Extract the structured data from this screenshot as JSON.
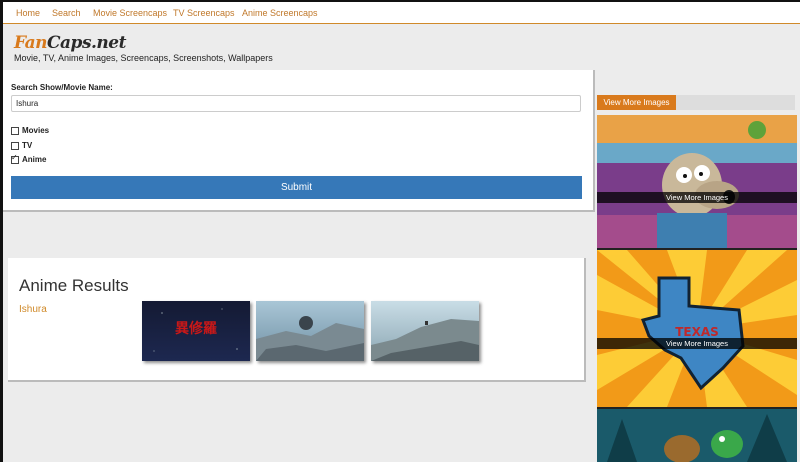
{
  "nav": {
    "items": [
      "Home",
      "Search",
      "Movie Screencaps",
      "TV Screencaps",
      "Anime Screencaps"
    ]
  },
  "logo": {
    "part1": "Fan",
    "part2": "Caps.net"
  },
  "tagline": "Movie, TV, Anime Images, Screencaps, Screenshots, Wallpapers",
  "search": {
    "label": "Search Show/Movie Name:",
    "value": "Ishura",
    "options": [
      {
        "label": "Movies",
        "checked": false
      },
      {
        "label": "TV",
        "checked": false
      },
      {
        "label": "Anime",
        "checked": true
      }
    ],
    "submit_label": "Submit"
  },
  "results": {
    "title": "Anime Results",
    "show_name": "Ishura",
    "thumbnails": [
      {
        "title_art": "異修羅",
        "icon": "anime-title-card"
      },
      {
        "icon": "rocky-landscape"
      },
      {
        "icon": "rocky-landscape"
      }
    ]
  },
  "sidebar": {
    "header_button": "View More Images",
    "cards": [
      {
        "label": "View More Images",
        "icon": "cartoon-wallaby-image"
      },
      {
        "label": "View More Images",
        "icon": "texas-map-sunburst-image"
      },
      {
        "label": "",
        "icon": "cartoon-dogs-forest-image"
      }
    ]
  },
  "colors": {
    "accent": "#d97a1c",
    "submit": "#3678b8",
    "link": "#d08a2a"
  }
}
